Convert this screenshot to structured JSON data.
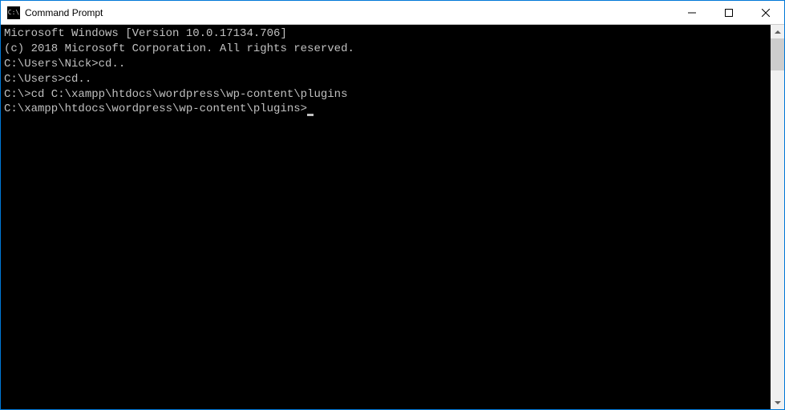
{
  "window": {
    "title": "Command Prompt"
  },
  "terminal": {
    "lines": [
      "Microsoft Windows [Version 10.0.17134.706]",
      "(c) 2018 Microsoft Corporation. All rights reserved.",
      "",
      "C:\\Users\\Nick>cd..",
      "",
      "C:\\Users>cd..",
      "",
      "C:\\>cd C:\\xampp\\htdocs\\wordpress\\wp-content\\plugins",
      "",
      "C:\\xampp\\htdocs\\wordpress\\wp-content\\plugins>"
    ]
  }
}
